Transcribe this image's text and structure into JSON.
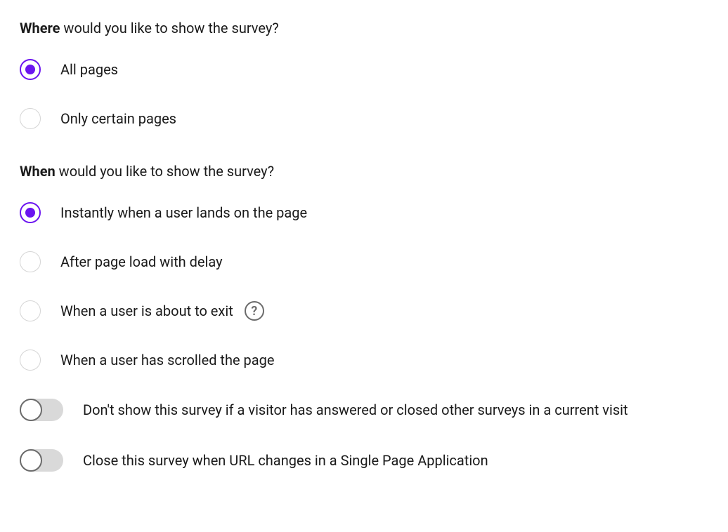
{
  "where": {
    "heading_bold": "Where",
    "heading_rest": " would you like to show the survey?",
    "options": {
      "all_pages": "All pages",
      "certain_pages": "Only certain pages"
    }
  },
  "when": {
    "heading_bold": "When",
    "heading_rest": " would you like to show the survey?",
    "options": {
      "instantly": "Instantly when a user lands on the page",
      "after_delay": "After page load with delay",
      "about_to_exit": "When a user is about to exit",
      "scrolled": "When a user has scrolled the page"
    }
  },
  "toggles": {
    "dont_show_if_answered": "Don't show this survey if a visitor has answered or closed other surveys in a current visit",
    "close_on_url_change": "Close this survey when URL changes in a Single Page Application"
  },
  "help_icon_glyph": "?"
}
